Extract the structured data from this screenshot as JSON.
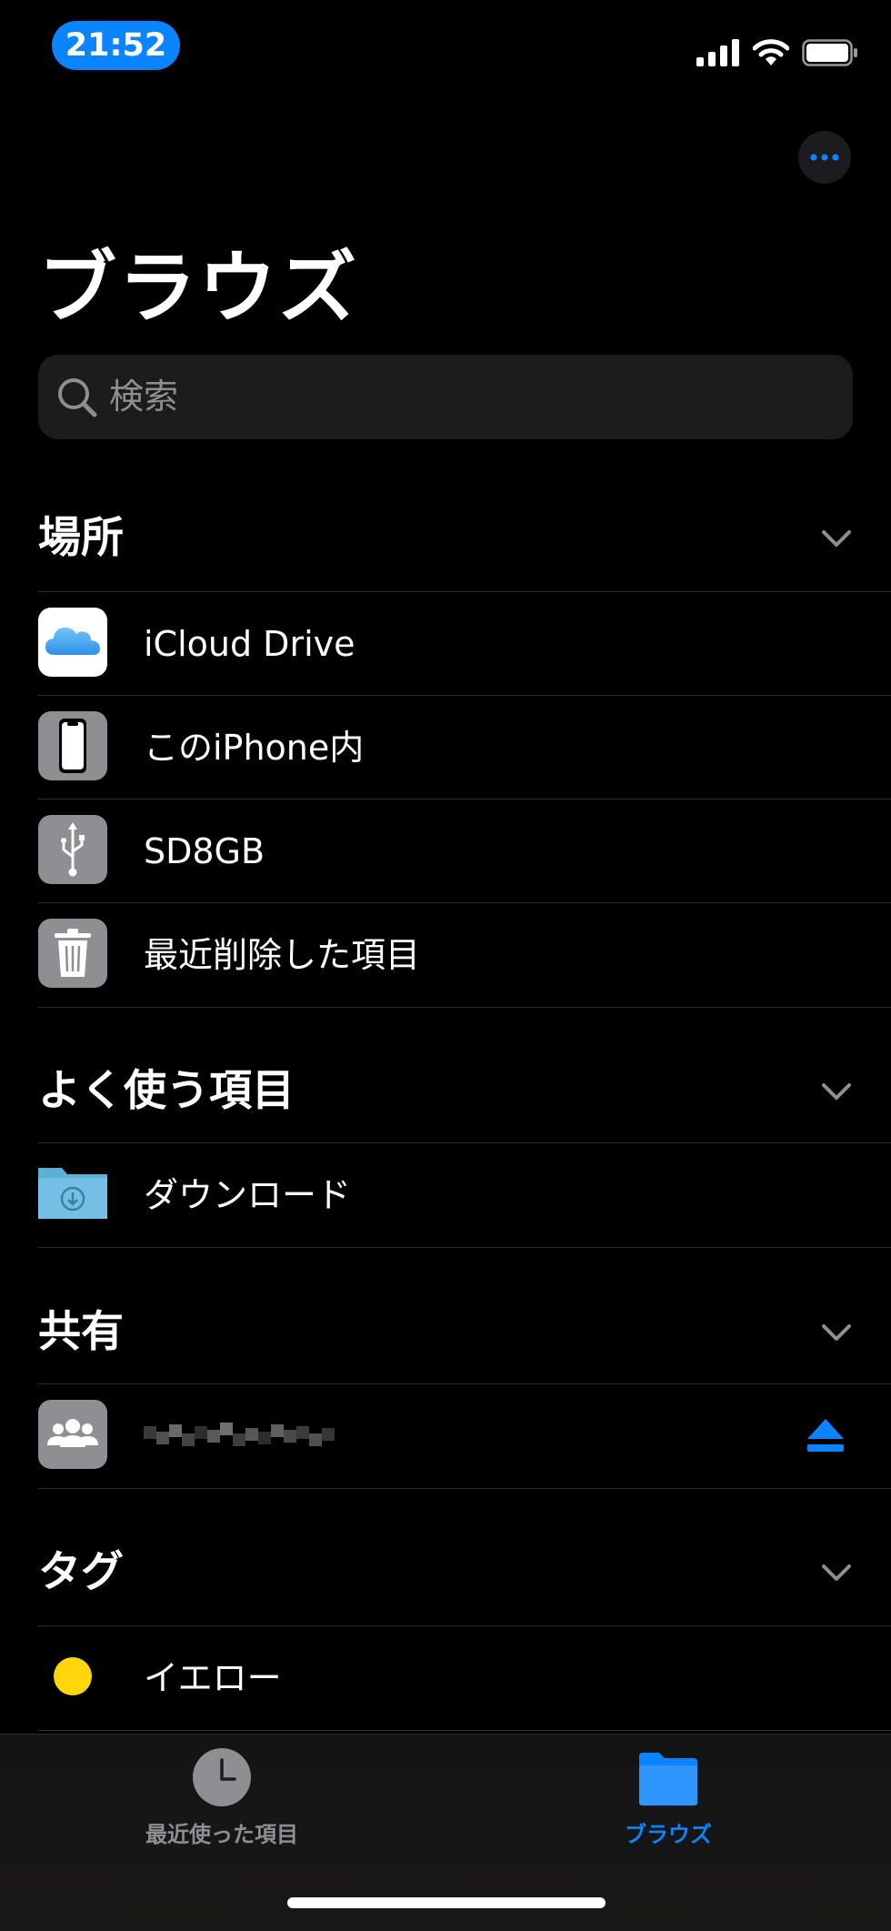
{
  "status_bar": {
    "time": "21:52"
  },
  "header": {
    "title": "ブラウズ"
  },
  "search": {
    "placeholder": "検索"
  },
  "sections": {
    "locations": {
      "title": "場所",
      "items": [
        {
          "label": "iCloud Drive",
          "icon": "icloud-icon"
        },
        {
          "label": "このiPhone内",
          "icon": "iphone-icon"
        },
        {
          "label": "SD8GB",
          "icon": "usb-icon"
        },
        {
          "label": "最近削除した項目",
          "icon": "trash-icon"
        }
      ]
    },
    "favorites": {
      "title": "よく使う項目",
      "items": [
        {
          "label": "ダウンロード",
          "icon": "download-folder-icon"
        }
      ]
    },
    "shared": {
      "title": "共有",
      "items": [
        {
          "label": "",
          "icon": "group-icon"
        }
      ]
    },
    "tags": {
      "title": "タグ",
      "items": [
        {
          "label": "イエロー",
          "color": "#ffd60a"
        }
      ]
    }
  },
  "tab_bar": {
    "tabs": [
      {
        "label": "最近使った項目",
        "icon": "clock-icon",
        "active": false
      },
      {
        "label": "ブラウズ",
        "icon": "folder-icon",
        "active": true
      }
    ]
  },
  "colors": {
    "accent": "#0a84ff",
    "background": "#000000",
    "tag_yellow": "#ffd60a"
  }
}
